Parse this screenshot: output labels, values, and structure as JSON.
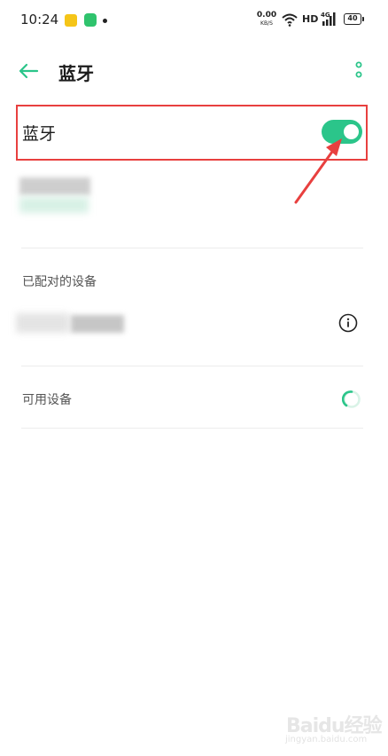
{
  "status_bar": {
    "time": "10:24",
    "net_speed_value": "0.00",
    "net_speed_unit": "KB/S",
    "network_type": "HD",
    "signal_label": "4G",
    "battery": "40"
  },
  "header": {
    "title": "蓝牙"
  },
  "bluetooth": {
    "label": "蓝牙",
    "enabled": true,
    "accent_color": "#2bc58a"
  },
  "annotation": {
    "color": "#e8403f"
  },
  "sections": {
    "paired_label": "已配对的设备",
    "available_label": "可用设备"
  },
  "watermark": {
    "logo": "Baidu经验",
    "url": "jingyan.baidu.com"
  },
  "icons": {
    "back": "back-arrow-icon",
    "more": "more-vertical-icon",
    "info": "info-icon",
    "spinner": "loading-spinner-icon",
    "wifi": "wifi-icon",
    "signal": "signal-icon",
    "battery": "battery-icon"
  }
}
